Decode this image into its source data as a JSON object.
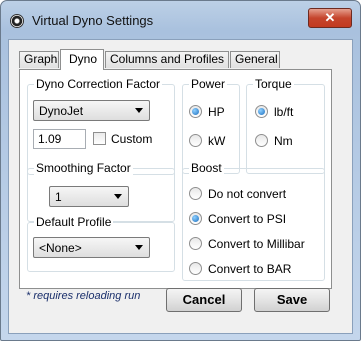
{
  "window": {
    "title": "Virtual Dyno Settings",
    "close_glyph": "✕"
  },
  "tabs": [
    {
      "label": "Graph"
    },
    {
      "label": "Dyno",
      "active": true
    },
    {
      "label": "Columns and Profiles"
    },
    {
      "label": "General"
    }
  ],
  "dyno_correction": {
    "label": "Dyno Correction Factor",
    "selected": "DynoJet",
    "factor_value": "1.09",
    "custom_label": "Custom",
    "custom_checked": false
  },
  "power": {
    "label": "Power",
    "options": [
      {
        "label": "HP",
        "selected": true
      },
      {
        "label": "kW",
        "selected": false
      }
    ]
  },
  "torque": {
    "label": "Torque",
    "options": [
      {
        "label": "lb/ft",
        "selected": true
      },
      {
        "label": "Nm",
        "selected": false
      }
    ]
  },
  "smoothing": {
    "label": "Smoothing Factor",
    "selected": "1"
  },
  "default_profile": {
    "label": "Default Profile",
    "selected": "<None>"
  },
  "boost": {
    "label": "Boost",
    "options": [
      {
        "label": "Do not convert",
        "selected": false
      },
      {
        "label": "Convert to PSI",
        "selected": true
      },
      {
        "label": "Convert to Millibar",
        "selected": false
      },
      {
        "label": "Convert to BAR",
        "selected": false
      }
    ]
  },
  "footer": {
    "note": "* requires reloading run",
    "cancel_label": "Cancel",
    "save_label": "Save"
  }
}
